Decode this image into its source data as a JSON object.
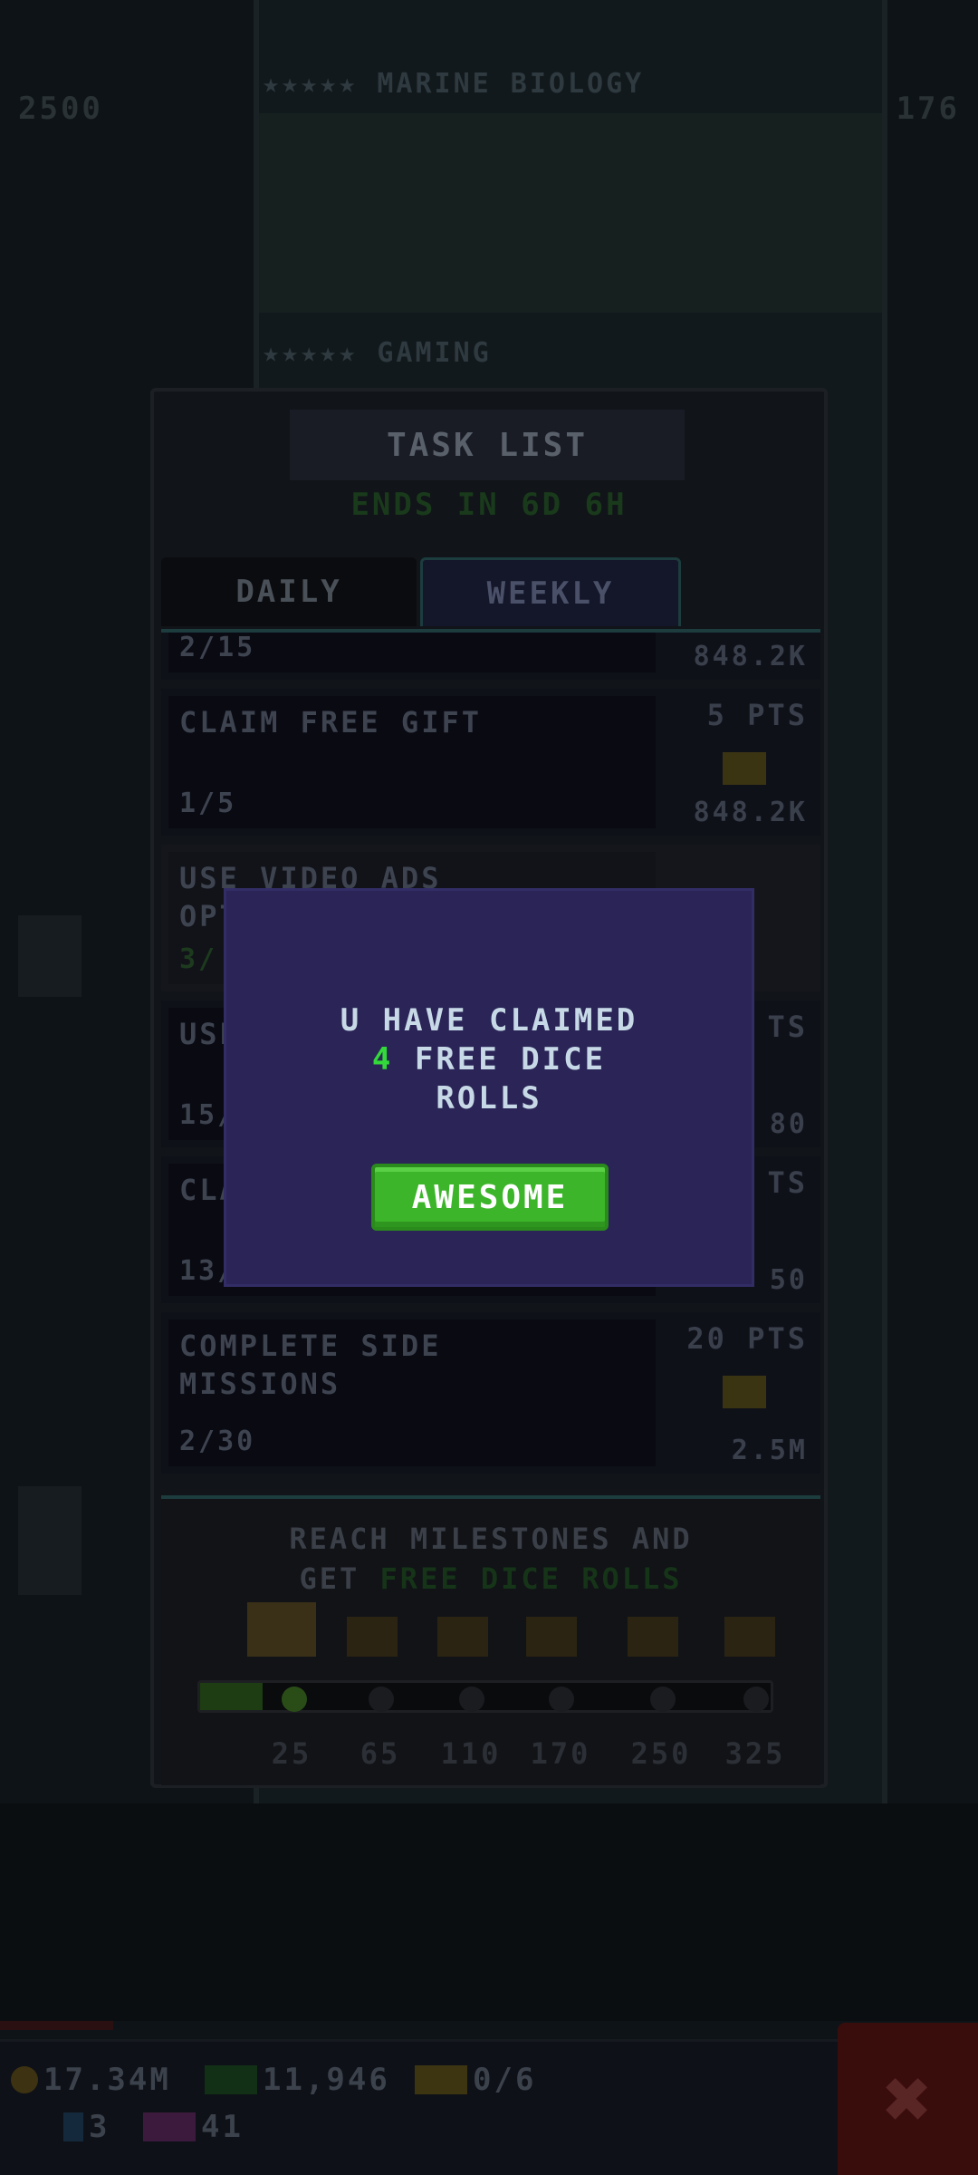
{
  "background": {
    "left_stat": "2500",
    "right_stat": "176",
    "floors": [
      {
        "label": "★★★★★ MARINE BIOLOGY"
      },
      {
        "label": "★★★★★ GAMING"
      }
    ]
  },
  "task_list": {
    "title": "TASK LIST",
    "ends_in": "ENDS IN 6D 6H",
    "tabs": [
      {
        "label": "DAILY",
        "active": false
      },
      {
        "label": "WEEKLY",
        "active": true
      }
    ],
    "tasks": [
      {
        "title": "",
        "progress": "2/15",
        "points": "",
        "reward": "848.2K"
      },
      {
        "title": "CLAIM FREE GIFT",
        "progress": "1/5",
        "points": "5 PTS",
        "reward": "848.2K"
      },
      {
        "title": "USE VIDEO ADS OPTIONS",
        "progress": "3/",
        "points": "",
        "reward": ""
      },
      {
        "title": "USE",
        "progress": "15/",
        "points": "TS",
        "reward": "80"
      },
      {
        "title": "CLA",
        "progress": "13/",
        "points": "TS",
        "reward": "50"
      },
      {
        "title": "COMPLETE SIDE MISSIONS",
        "progress": "2/30",
        "points": "20 PTS",
        "reward": "2.5M"
      }
    ],
    "milestones": {
      "text_line1": "REACH MILESTONES AND",
      "text_line2_prefix": "GET ",
      "text_line2_highlight": "FREE DICE ROLLS",
      "values": [
        "25",
        "65",
        "110",
        "170",
        "250",
        "325"
      ],
      "progress_fraction": 0.11
    }
  },
  "hud": {
    "coins": "17.34M",
    "cash": "11,946",
    "tickets": "0/6",
    "gems": "3",
    "vip": "41"
  },
  "modal": {
    "line1": "U HAVE CLAIMED",
    "count": "4",
    "line2_rest": " FREE DICE",
    "line3": "ROLLS",
    "button_label": "AWESOME"
  },
  "colors": {
    "modal_bg": "#2a2457",
    "button_green": "#3cb52a",
    "highlight_green": "#33d93a",
    "text_light": "#c7d9e6"
  }
}
